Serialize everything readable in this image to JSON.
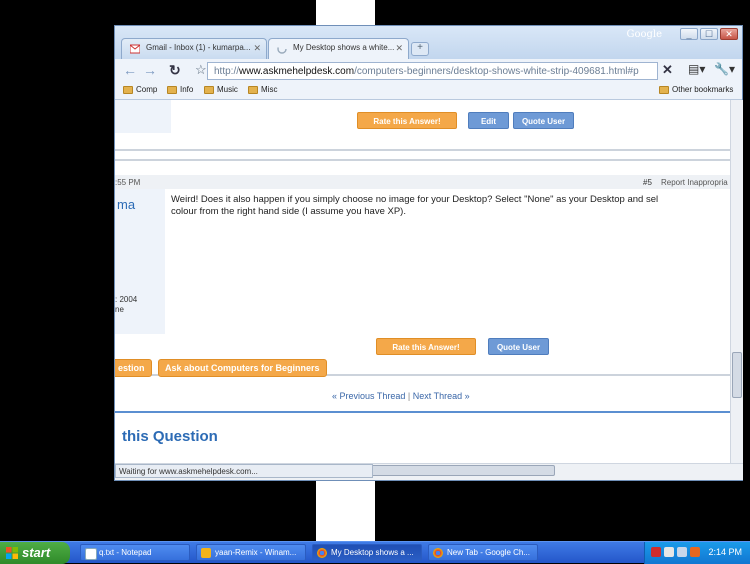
{
  "window": {
    "brand": "Google",
    "controls": [
      "_",
      "☐",
      "✕"
    ]
  },
  "tabs": [
    {
      "label": "Gmail - Inbox (1) - kumarpa...",
      "active": false
    },
    {
      "label": "My Desktop shows a white...",
      "active": true
    }
  ],
  "newtab_label": "+",
  "address": {
    "scheme": "http://",
    "host": "www.askmehelpdesk.com",
    "path": "/computers-beginners/desktop-shows-white-strip-409681.html#p"
  },
  "bookmarks": [
    {
      "label": "Comp"
    },
    {
      "label": "Info"
    },
    {
      "label": "Music"
    },
    {
      "label": "Misc"
    }
  ],
  "other_bookmarks": "Other bookmarks",
  "page": {
    "prev_post_buttons": {
      "rate": "Rate this Answer!",
      "edit": "Edit",
      "quote": "Quote User"
    },
    "post": {
      "time_fragment": ":55 PM",
      "number": "#5",
      "report": "Report Inappropria",
      "author_fragment": "ma",
      "meta_line1": ": 2004",
      "meta_line2": "ne",
      "text_line1": "Weird! Does it also happen if you simply choose no image for your Desktop? Select \"None\" as your Desktop and sel",
      "text_line2": "colour from the right hand side (I assume you have XP).",
      "rate": "Rate this Answer!",
      "quote": "Quote User"
    },
    "ask_buttons": [
      "estion",
      "Ask about Computers for Beginners"
    ],
    "thread_nav": {
      "prev_arrow": "«",
      "prev": "Previous Thread",
      "separator": "|",
      "next": "Next Thread",
      "next_arrow": "»"
    },
    "section_title": "this Question"
  },
  "status_text": "Waiting for www.askmehelpdesk.com...",
  "taskbar": {
    "start": "start",
    "items": [
      {
        "label": "q.txt - Notepad",
        "active": false
      },
      {
        "label": "yaan-Remix - Winam...",
        "active": false
      },
      {
        "label": "My Desktop shows a ...",
        "active": true
      },
      {
        "label": "New Tab - Google Ch...",
        "active": false
      }
    ],
    "clock": "2:14 PM"
  }
}
